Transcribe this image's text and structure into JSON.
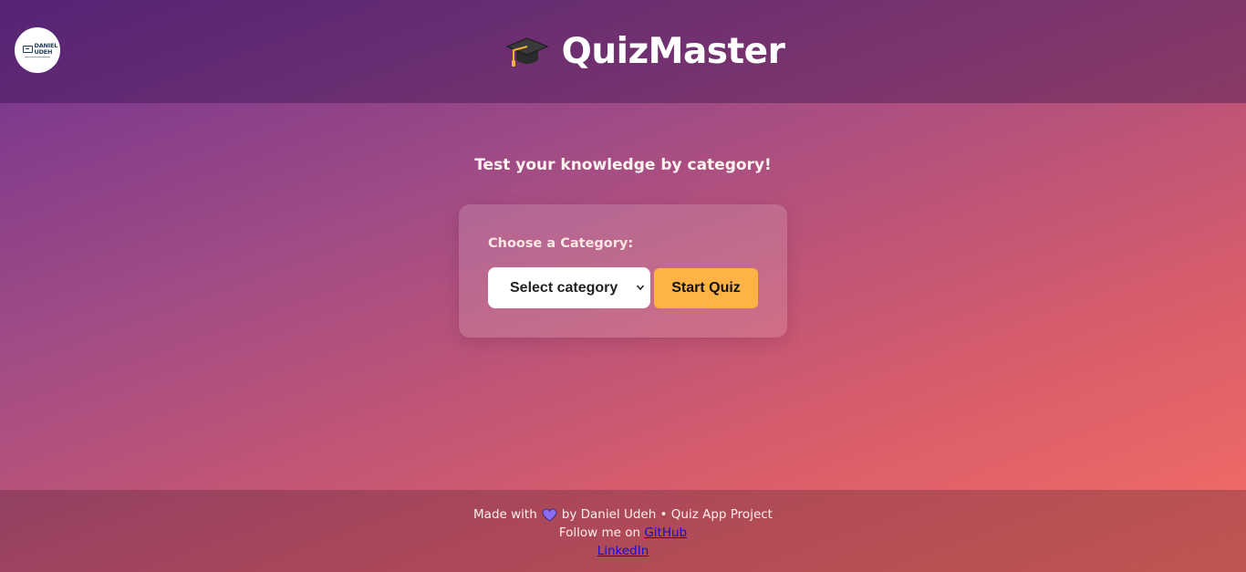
{
  "header": {
    "logo_text": "DANIEL UDEH",
    "title": "QuizMaster",
    "title_icon": "graduation-cap-icon"
  },
  "main": {
    "tagline": "Test your knowledge by category!",
    "card": {
      "label": "Choose a Category:",
      "select_value": "Select category",
      "start_button": "Start Quiz"
    }
  },
  "footer": {
    "made_with": "Made with",
    "heart_icon": "purple-heart-icon",
    "byline": "by Daniel Udeh • Quiz App Project",
    "follow_text": "Follow me on",
    "github_link": "GitHub",
    "linkedin_link": "LinkedIn"
  },
  "colors": {
    "accent_button": "#ffb347",
    "link": "#1a0dcc",
    "heart": "#8b6cf0"
  }
}
